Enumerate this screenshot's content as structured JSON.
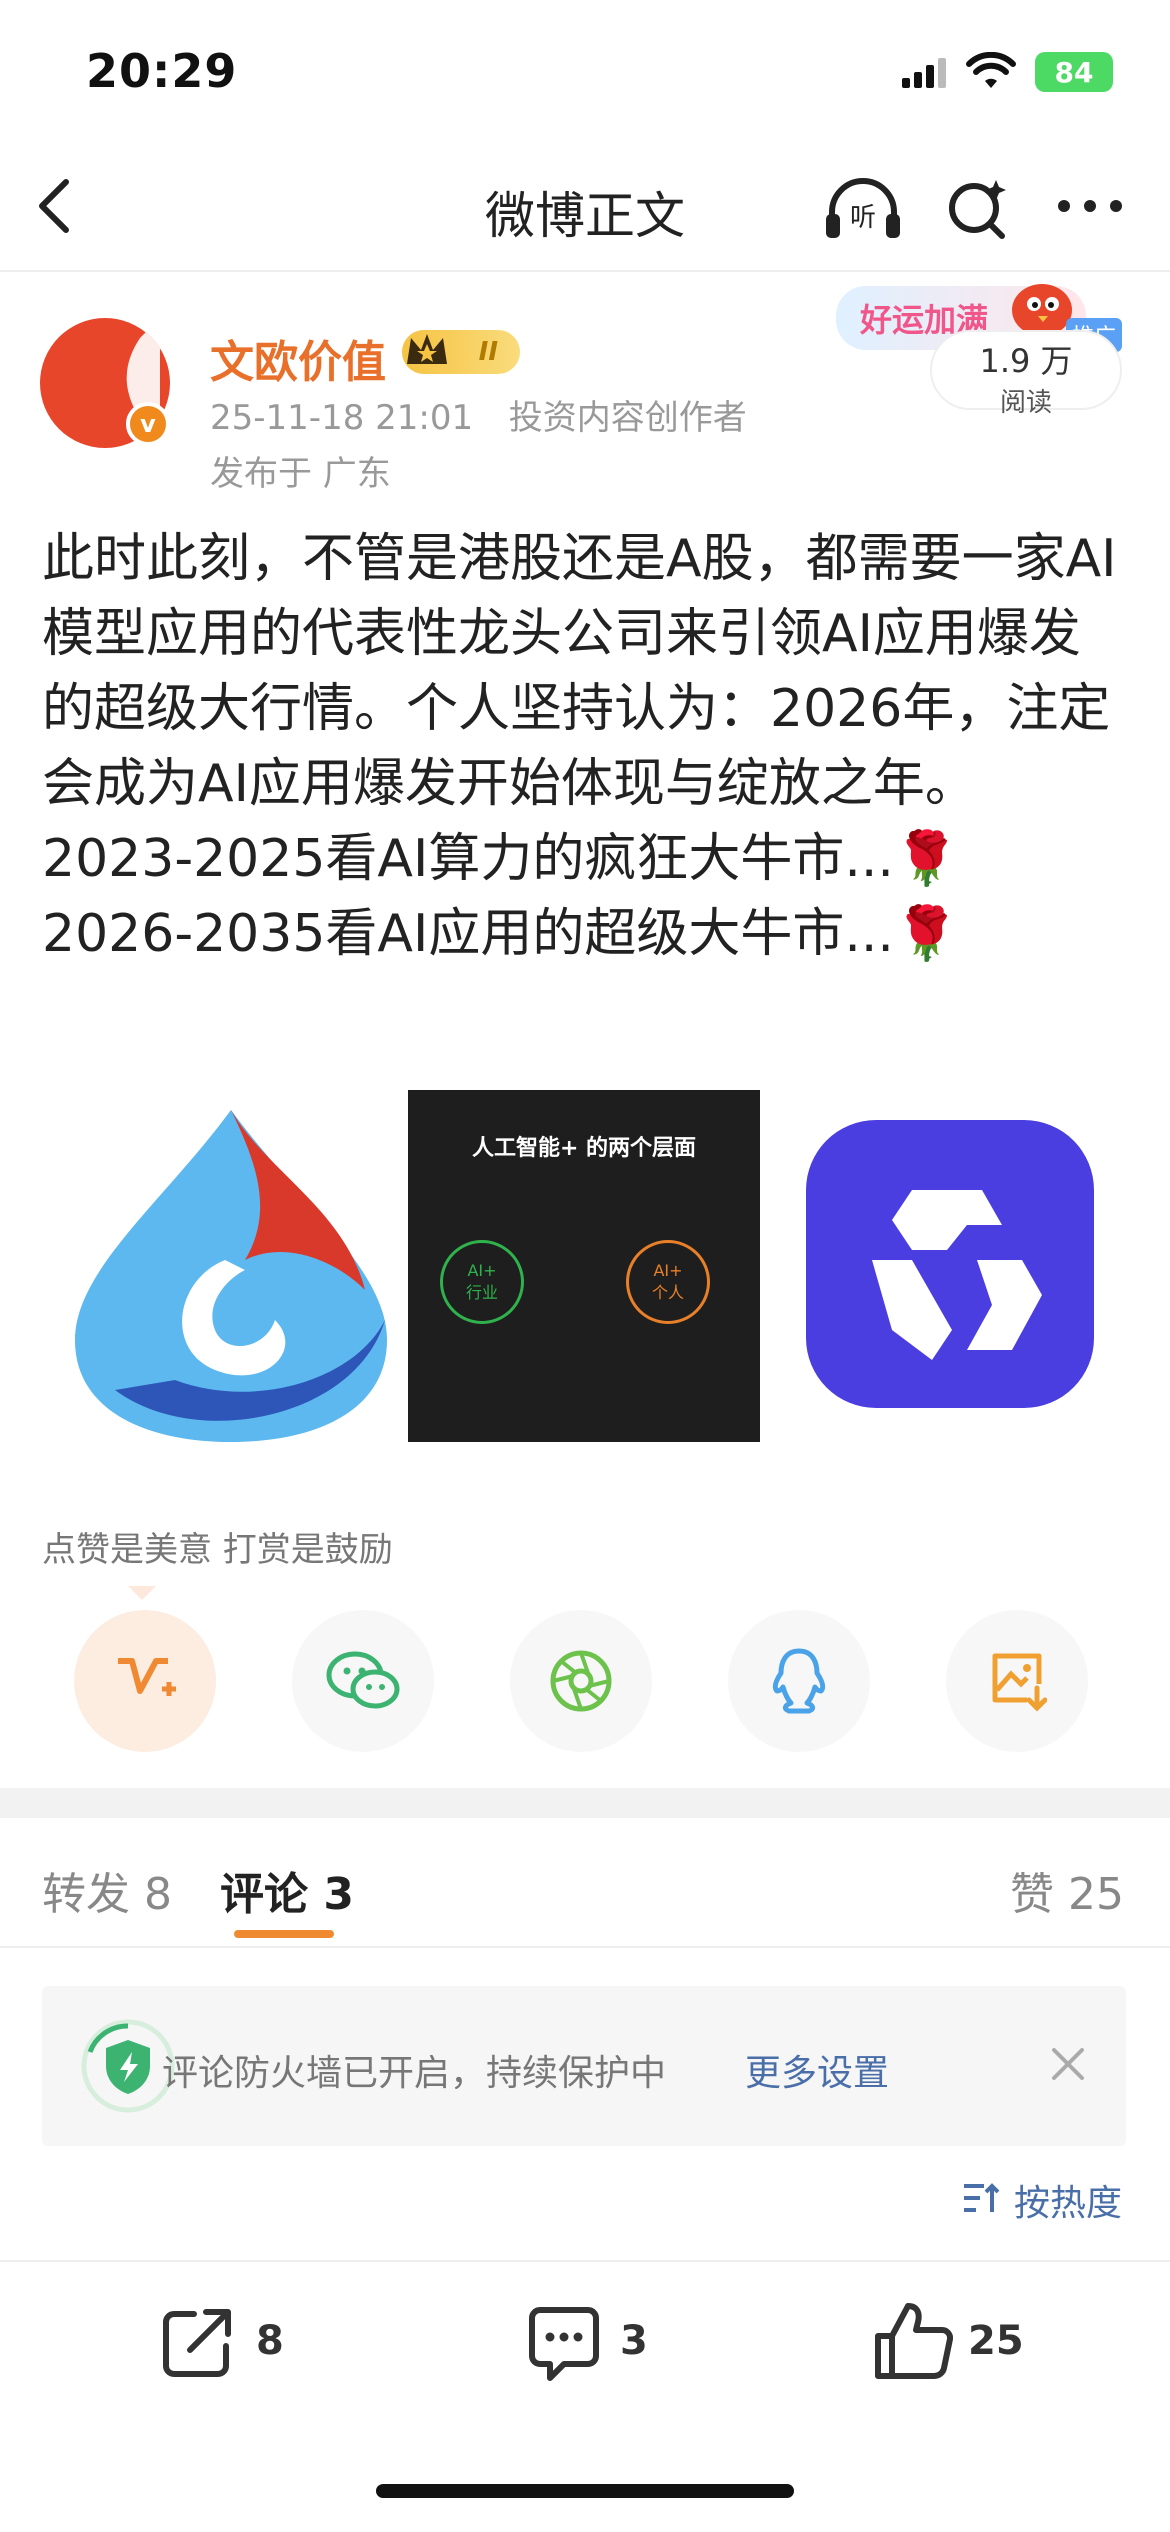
{
  "status_bar": {
    "time": "20:29",
    "battery": "84"
  },
  "nav": {
    "title": "微博正文"
  },
  "author": {
    "name": "文欧价值",
    "level_badge": "II",
    "date": "25-11-18 21:01",
    "role": "投资内容创作者",
    "location": "发布于 广东",
    "verified_badge": "v"
  },
  "ad": {
    "banner": "好运加满",
    "tag": "推广",
    "reads_count": "1.9 万",
    "reads_label": "阅读"
  },
  "post": {
    "paragraph1": "此时此刻，不管是港股还是A股，都需要一家AI模型应用的代表性龙头公司来引领AI应用爆发的超级大行情。个人坚持认为：2026年，注定会成为AI应用爆发开始体现与绽放之年。",
    "line2": "2023-2025看AI算力的疯狂大牛市...",
    "line3": "2026-2035看AI应用的超级大牛市...",
    "emoji": "🌹"
  },
  "images": {
    "image2_title": "人工智能+ 的两个层面",
    "image2_left": "AI+\n行业",
    "image2_right": "AI+\n个人"
  },
  "reward": {
    "text": "点赞是美意  打赏是鼓励"
  },
  "tabs": {
    "repost_label": "转发",
    "repost_count": "8",
    "comment_label": "评论",
    "comment_count": "3",
    "like_label": "赞",
    "like_count": "25"
  },
  "firewall": {
    "text": "评论防火墙已开启，持续保护中",
    "link": "更多设置"
  },
  "sort": {
    "label": "按热度"
  },
  "bottom_bar": {
    "share_count": "8",
    "comment_count": "3",
    "like_count": "25"
  },
  "colors": {
    "accent": "#f08a32",
    "link": "#4a6fa8",
    "author": "#e8702a"
  }
}
